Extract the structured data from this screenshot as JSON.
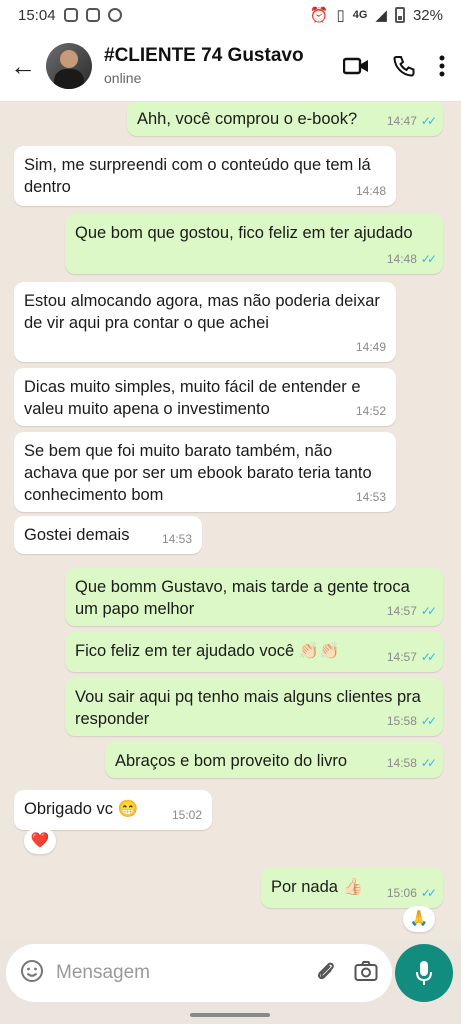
{
  "status_bar": {
    "time": "15:04",
    "network": "4G",
    "battery": "32%"
  },
  "header": {
    "contact_name": "#CLIENTE 74 Gustavo",
    "status": "online"
  },
  "messages": [
    {
      "side": "out",
      "text": "Ahh, você comprou o e-book?",
      "time": "14:47",
      "read": "✓✓"
    },
    {
      "side": "in",
      "text": "Sim, me surpreendi com o conteúdo que tem lá dentro",
      "time": "14:48"
    },
    {
      "side": "out",
      "text": "Que bom que gostou, fico feliz em ter ajudado",
      "time": "14:48",
      "read": "✓✓"
    },
    {
      "side": "in",
      "text": "Estou almocando agora, mas não poderia deixar de vir aqui pra contar o que achei",
      "time": "14:49"
    },
    {
      "side": "in",
      "text": "Dicas muito simples, muito fácil de entender e valeu muito apena o investimento",
      "time": "14:52"
    },
    {
      "side": "in",
      "text": "Se bem que foi muito barato também, não achava que por ser um ebook barato teria tanto conhecimento bom",
      "time": "14:53"
    },
    {
      "side": "in",
      "text": "Gostei demais",
      "time": "14:53"
    },
    {
      "side": "out",
      "text": "Que bomm Gustavo, mais tarde a gente troca um papo melhor",
      "time": "14:57",
      "read": "✓✓"
    },
    {
      "side": "out",
      "text": "Fico feliz em ter ajudado você 👏🏻👏🏻",
      "time": "14:57",
      "read": "✓✓"
    },
    {
      "side": "out",
      "text": "Vou sair aqui pq tenho mais alguns clientes pra responder",
      "time": "15:58",
      "read": "✓✓"
    },
    {
      "side": "out",
      "text": "Abraços e bom proveito do livro",
      "time": "14:58",
      "read": "✓✓"
    },
    {
      "side": "in",
      "text": "Obrigado vc 😁",
      "time": "15:02",
      "reaction": "❤️"
    },
    {
      "side": "out",
      "text": "Por nada 👍🏻",
      "time": "15:06",
      "read": "✓✓",
      "reaction": "🙏"
    }
  ],
  "composer": {
    "placeholder": "Mensagem"
  },
  "colors": {
    "outgoing_bubble": "#dcf8c6",
    "incoming_bubble": "#ffffff",
    "accent": "#128c7e",
    "read_ticks": "#34b7f1"
  }
}
